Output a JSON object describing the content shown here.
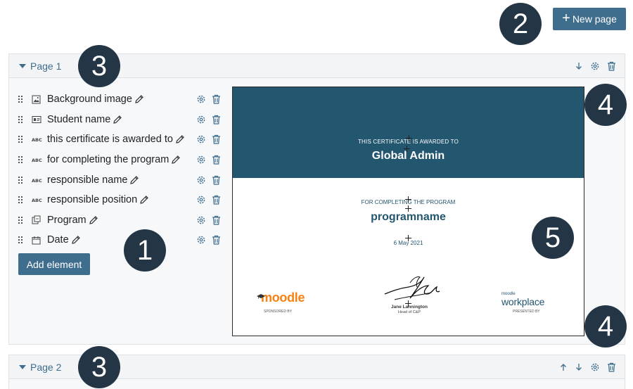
{
  "toolbar": {
    "new_page_label": "New page",
    "new_page_icon": "plus-icon"
  },
  "colors": {
    "accent": "#3f6d8d",
    "certificate_band": "#23566f",
    "callout": "#243646",
    "moodle_orange": "#f98012"
  },
  "pages": [
    {
      "title": "Page 1",
      "elements": [
        {
          "label": "Background image",
          "type_icon": "image-icon"
        },
        {
          "label": "Student name",
          "type_icon": "id-card-icon"
        },
        {
          "label": "this certificate is awarded to",
          "type_icon": "text-abc-icon"
        },
        {
          "label": "for completing the program",
          "type_icon": "text-abc-icon"
        },
        {
          "label": "responsible name",
          "type_icon": "text-abc-icon"
        },
        {
          "label": "responsible position",
          "type_icon": "text-abc-icon"
        },
        {
          "label": "Program",
          "type_icon": "program-icon"
        },
        {
          "label": "Date",
          "type_icon": "calendar-icon"
        }
      ],
      "add_element_label": "Add element",
      "certificate": {
        "awarded_text": "THIS CERTIFICATE IS AWARDED TO",
        "recipient": "Global Admin",
        "completing_text": "FOR COMPLETING THE PROGRAM",
        "program": "programname",
        "date": "6 May 2021",
        "left_logo": "moodle",
        "left_logo_caption": "SPONSORED BY",
        "signer_name": "Jane Lannington",
        "signer_role": "Head of C&P",
        "right_logo_top": "moodle",
        "right_logo": "workplace",
        "right_logo_caption": "PRESENTED BY"
      }
    },
    {
      "title": "Page 2"
    }
  ],
  "callouts": [
    "1",
    "2",
    "3",
    "3",
    "4",
    "4",
    "5"
  ]
}
